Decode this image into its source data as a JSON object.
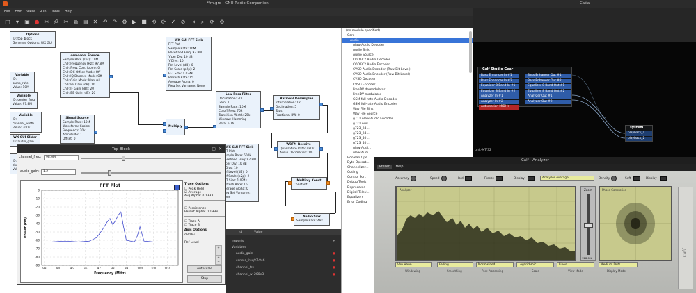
{
  "grc": {
    "title": "*fm.grc - GNU Radio Companion",
    "menu": [
      "File",
      "Edit",
      "View",
      "Run",
      "Tools",
      "Help"
    ],
    "blocks": [
      {
        "title": "Options",
        "lines": [
          "ID: top_block",
          "Generate Options: WX GUI"
        ]
      },
      {
        "title": "osmocom Source",
        "lines": [
          "Sample Rate (sps): 10M",
          "Ch0: Frequency (Hz): 97.8M",
          "Ch0: Freq. Corr. (ppm): 0",
          "Ch0: DC Offset Mode: Off",
          "Ch0: IQ Balance Mode: Off",
          "Ch0: Gain Mode: Manual",
          "Ch0: RF Gain (dB): 10",
          "Ch0: IF Gain (dB): 20",
          "Ch0: BB Gain (dB): 20"
        ]
      },
      {
        "title": "WX GUI FFT Sink",
        "lines": [
          "FFT Plot",
          "Sample Rate: 10M",
          "Baseband Freq: 97.8M",
          "Y per Div: 10 dB",
          "Y Divs: 10",
          "Ref Level (dB): 0",
          "Ref Scale (p2p): 2",
          "FFT Size: 1.024k",
          "Refresh Rate: 15",
          "Average Alpha: 0",
          "Freq Set Varname: None"
        ]
      },
      {
        "title": "Variable",
        "lines": [
          "ID: samp_rate",
          "Value: 10M"
        ]
      },
      {
        "title": "Variable",
        "lines": [
          "ID: center_freq",
          "Value: 97.8M"
        ]
      },
      {
        "title": "Variable",
        "lines": [
          "ID: channel_width",
          "Value: 200k"
        ]
      },
      {
        "title": "Signal Source",
        "lines": [
          "Sample Rate: 10M",
          "Waveform: Cosine",
          "Frequency: 20k",
          "Amplitude: 1",
          "Offset: 0"
        ]
      },
      {
        "title": "Multiply",
        "lines": []
      },
      {
        "title": "Low Pass Filter",
        "lines": [
          "Decimation: 20",
          "Gain: 1",
          "Sample Rate: 10M",
          "Cutoff Freq: 75k",
          "Transition Width: 25k",
          "Window: Hamming",
          "Beta: 6.76"
        ]
      },
      {
        "title": "Rational Resampler",
        "lines": [
          "Interpolation: 12",
          "Decimation: 5",
          "Taps:",
          "Fractional BW: 0"
        ]
      },
      {
        "title": "WBFM Receive",
        "lines": [
          "Quadrature Rate: 480k",
          "Audio Decimation: 10"
        ]
      },
      {
        "title": "Multiply Const",
        "lines": [
          "Constant: 1"
        ]
      },
      {
        "title": "Audio Sink",
        "lines": [
          "Sample Rate: 48k"
        ]
      },
      {
        "title": "WX GUI FFT Sink",
        "lines": [
          "FFT Plot",
          "Sample Rate: 500k",
          "Baseband Freq: 97.8M",
          "Y per Div: 10 dB",
          "Y Divs: 10",
          "Ref Level (dB): 0",
          "Ref Scale (p2p): 2",
          "FFT Size: 1.024k",
          "Refresh Rate: 15",
          "Average Alpha: 0",
          "Freq Set Varname: None"
        ]
      },
      {
        "title": "WX GUI Slider",
        "lines": [
          "ID: audio_gain"
        ]
      },
      {
        "title": "Variable",
        "lines": [
          "ID: channel_width",
          "Value: 200k"
        ]
      }
    ],
    "tree": {
      "top": "(no module specified)",
      "core": "Core",
      "audio": "Audio",
      "items": [
        "Alaw Audio Decoder",
        "Audio Sink",
        "Audio Source",
        "CODEC2 Audio Decoder",
        "CODEC2 Audio Encoder",
        "CVSD Audio Decoder (Raw Bit-Level)",
        "CVSD Audio Encoder (Raw Bit-Level)",
        "CVSD Decoder",
        "CVSD Encoder",
        "FreeDV demodulator",
        "FreeDV modulator",
        "GSM full-rate Audio Decoder",
        "GSM full-rate Audio Encoder",
        "Wav File Sink",
        "Wav File Source",
        "g711 Alaw Audio Encoder",
        "g721 Aud...",
        "g723_24 ...",
        "g723_24 ...",
        "g723_40 ...",
        "g723_40 ...",
        "ulaw Audi...",
        "ulaw Audi..."
      ],
      "sections": [
        "Boolean Ope...",
        "Byte Operat...",
        "Channelizer...",
        "Coding",
        "Control Port",
        "Debug Tools",
        "Deprecated",
        "Digital Televi...",
        "Equalizers",
        "Error Coding"
      ]
    },
    "props": {
      "head_id": "Id",
      "head_value": "Value",
      "imports": "Imports",
      "variables": "Variables",
      "vars": [
        {
          "name": "audio_gain",
          "value": ""
        },
        {
          "name": "center_freq",
          "value": "97.9e6"
        },
        {
          "name": "channel_fre",
          "value": ""
        },
        {
          "name": "channel_w",
          "value": "200e3"
        }
      ]
    }
  },
  "topblock": {
    "title": "Top Block",
    "channel_freq_label": "channel_freq:",
    "channel_freq_value": "98.0M",
    "audio_gain_label": "audio_gain:",
    "audio_gain_value": "1.2",
    "plot_title": "FFT Plot",
    "ylabel": "Power (dB)",
    "xlabel": "Frequency (MHz)",
    "trace_options": "Trace Options",
    "peak_hold": "Peak Hold",
    "average": "Average",
    "avg_alpha": "Avg Alpha: 0.1333",
    "persistence": "Persistence",
    "persist_alpha": "Persist Alpha: 0.1999",
    "trace_a": "Trace A",
    "trace_b": "Trace B",
    "axis_options": "Axis Options",
    "db_div": "dB/Div",
    "ref_level": "Ref Level",
    "autoscale": "Autoscale",
    "stop": "Stop"
  },
  "chart_data": {
    "type": "line",
    "title": "FFT Plot",
    "xlabel": "Frequency (MHz)",
    "ylabel": "Power (dB)",
    "xlim": [
      92.8,
      102.8
    ],
    "ylim": [
      -90,
      0
    ],
    "xticks": [
      93,
      94,
      95,
      96,
      97,
      98,
      99,
      100,
      101,
      102
    ],
    "yticks": [
      0,
      -10,
      -20,
      -30,
      -40,
      -50,
      -60,
      -70,
      -80,
      -90
    ],
    "series": [
      {
        "x": [
          92.8,
          93.5,
          94.5,
          95.5,
          96.3,
          96.8,
          97.0,
          97.3,
          97.6,
          97.8,
          98.0,
          98.2,
          98.4,
          98.6,
          98.8,
          99.0,
          99.3,
          99.6,
          99.8,
          100.0,
          100.3,
          101.0,
          102.0,
          102.8
        ],
        "y": [
          -62,
          -62,
          -61,
          -62,
          -61,
          -57,
          -53,
          -46,
          -38,
          -34,
          -41,
          -37,
          -30,
          -26,
          -44,
          -60,
          -61,
          -62,
          -55,
          -44,
          -61,
          -62,
          -62,
          -62
        ]
      }
    ],
    "grid": true
  },
  "catia": {
    "title": "Catia",
    "gear_title": "Calf Studio Gear",
    "outs": [
      "Bass Enhancer In #1",
      "Bass Enhancer In #2",
      "Equalizer 8 Band In #1",
      "Equalizer 8 Band In #2",
      "Analyzer In #1",
      "Analyzer In #2",
      "Automation MIDI In"
    ],
    "ins": [
      "Bass Enhancer Out #1",
      "Bass Enhancer Out #2",
      "Equalizer 8 Band Out #1",
      "Equalizer 8 Band Out #2",
      "Analyzer Out #1",
      "Analyzer Out #2"
    ],
    "system_title": "system",
    "system_ports": [
      "playback_1",
      "playback_2"
    ],
    "bottom_label": "unit-MT-32"
  },
  "analyzer": {
    "title": "Calf - Analyzer",
    "menu": [
      "Preset",
      "Help"
    ],
    "controls": [
      {
        "label": "Accuracy"
      },
      {
        "label": "Speed"
      },
      {
        "label": "Hold"
      },
      {
        "label": "Freeze"
      },
      {
        "label": "Display"
      },
      {
        "label": "Density"
      },
      {
        "label": "Soft"
      },
      {
        "label": "Display"
      }
    ],
    "mode_select": "Analyzer Average",
    "analyzer_label": "Analyzer",
    "phase_label": "Phase Correlation",
    "zoom_label": "Zoom",
    "zoom_value": "128.0%",
    "selects": [
      {
        "value": "Von Hann",
        "caption": "Windowing"
      },
      {
        "value": "Falling",
        "caption": "Smoothing"
      },
      {
        "value": "Normalized",
        "caption": "Post Processing"
      },
      {
        "value": "Logarithmic",
        "caption": "Scale"
      },
      {
        "value": "Lines",
        "caption": "View Mode"
      },
      {
        "value": "Medium Dots",
        "caption": "Display Mode"
      }
    ],
    "brand": "calf"
  }
}
